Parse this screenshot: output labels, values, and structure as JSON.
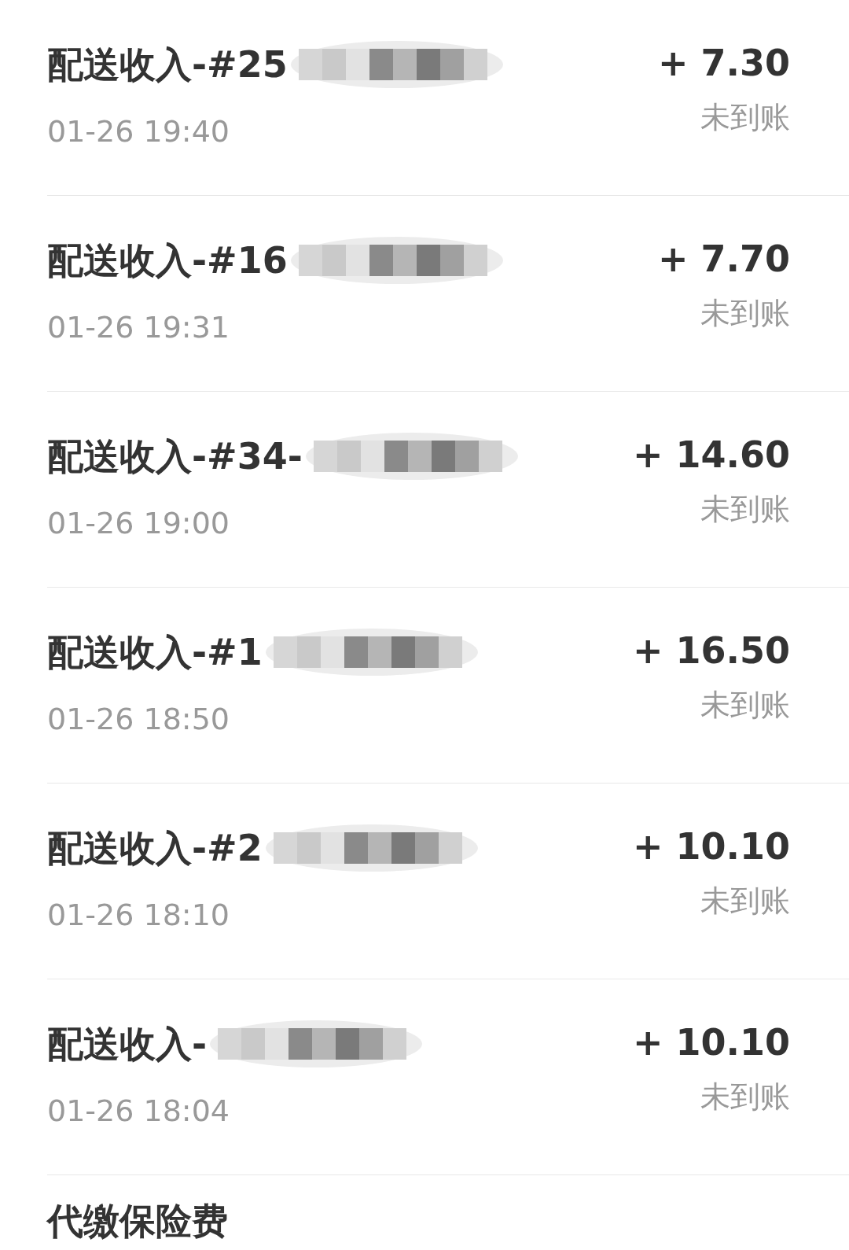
{
  "records": [
    {
      "kind": "income",
      "title": "配送收入-#25",
      "time": "01-26 19:40",
      "amount": "+ 7.30",
      "status": "未到账"
    },
    {
      "kind": "income",
      "title": "配送收入-#16",
      "time": "01-26 19:31",
      "amount": "+ 7.70",
      "status": "未到账"
    },
    {
      "kind": "income",
      "title": "配送收入-#34-",
      "time": "01-26 19:00",
      "amount": "+ 14.60",
      "status": "未到账"
    },
    {
      "kind": "income",
      "title": "配送收入-#1",
      "time": "01-26 18:50",
      "amount": "+ 16.50",
      "status": "未到账"
    },
    {
      "kind": "income",
      "title": "配送收入-#2",
      "time": "01-26 18:10",
      "amount": "+ 10.10",
      "status": "未到账"
    },
    {
      "kind": "income",
      "title": "配送收入-",
      "time": "01-26 18:04",
      "amount": "+ 10.10",
      "status": "未到账"
    },
    {
      "kind": "partial",
      "title": "代缴保险费"
    }
  ]
}
